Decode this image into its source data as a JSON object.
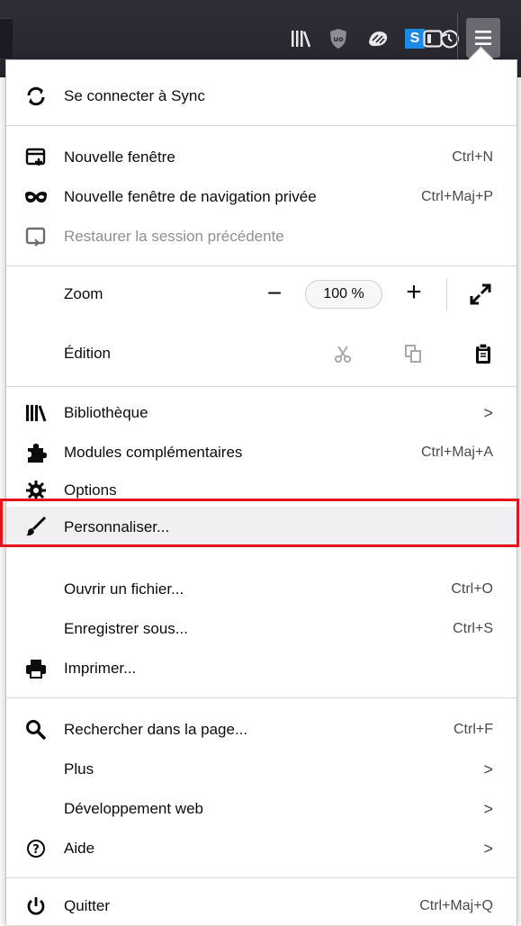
{
  "toolbar": {
    "icons": [
      "library-icon",
      "ublock-origin-icon",
      "extension-icon",
      "simplenote-icon",
      "history-icon",
      "sidebar-icon",
      "hamburger-menu-icon"
    ],
    "simplenote_letter": "S"
  },
  "menu": {
    "sync": {
      "label": "Se connecter à Sync"
    },
    "new_window": {
      "label": "Nouvelle fenêtre",
      "shortcut": "Ctrl+N"
    },
    "private_window": {
      "label": "Nouvelle fenêtre de navigation privée",
      "shortcut": "Ctrl+Maj+P"
    },
    "restore_session": {
      "label": "Restaurer la session précédente"
    },
    "zoom": {
      "label": "Zoom",
      "minus": "−",
      "value": "100 %",
      "plus": "+"
    },
    "edit": {
      "label": "Édition"
    },
    "library": {
      "label": "Bibliothèque",
      "chevron": ">"
    },
    "addons": {
      "label": "Modules complémentaires",
      "shortcut": "Ctrl+Maj+A"
    },
    "options": {
      "label": "Options"
    },
    "customize": {
      "label": "Personnaliser..."
    },
    "open_file": {
      "label": "Ouvrir un fichier...",
      "shortcut": "Ctrl+O"
    },
    "save_as": {
      "label": "Enregistrer sous...",
      "shortcut": "Ctrl+S"
    },
    "print": {
      "label": "Imprimer..."
    },
    "find": {
      "label": "Rechercher dans la page...",
      "shortcut": "Ctrl+F"
    },
    "more": {
      "label": "Plus",
      "chevron": ">"
    },
    "web_dev": {
      "label": "Développement web",
      "chevron": ">"
    },
    "help": {
      "label": "Aide",
      "chevron": ">"
    },
    "quit": {
      "label": "Quitter",
      "shortcut": "Ctrl+Maj+Q"
    }
  },
  "colors": {
    "toolbar_bg": "#2b2a33",
    "highlight_box": "#e4141b",
    "simplenote_blue": "#1e88e5"
  }
}
